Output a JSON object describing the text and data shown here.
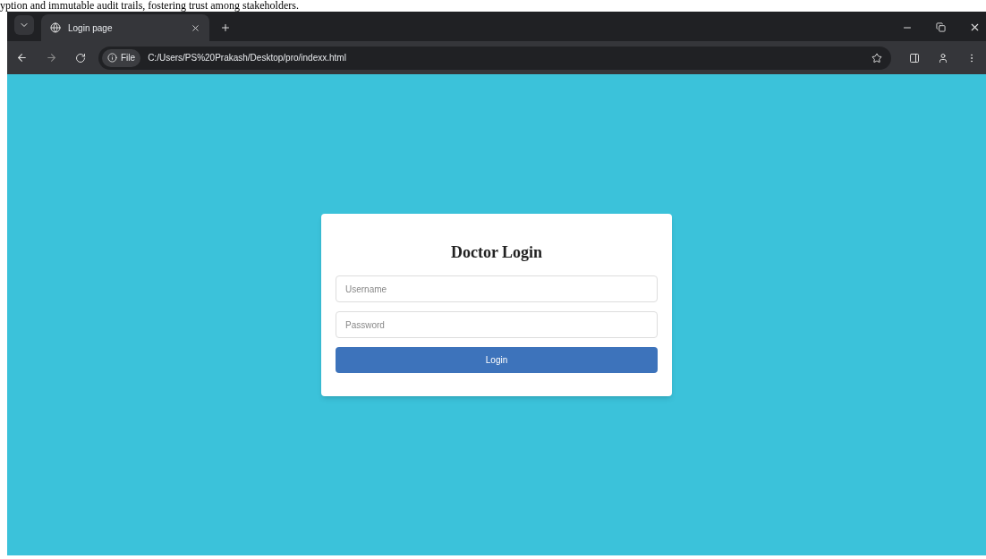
{
  "document_text": "yption and immutable audit trails, fostering trust among stakeholders.",
  "browser": {
    "tabs": [
      {
        "title": "Login page",
        "selected": true
      }
    ],
    "address_bar": {
      "scheme_label": "File",
      "url": "C:/Users/PS%20Prakash/Desktop/pro/indexx.html"
    }
  },
  "login_card": {
    "title": "Doctor Login",
    "username": {
      "placeholder": "Username"
    },
    "password": {
      "placeholder": "Password"
    },
    "button": "Login"
  }
}
